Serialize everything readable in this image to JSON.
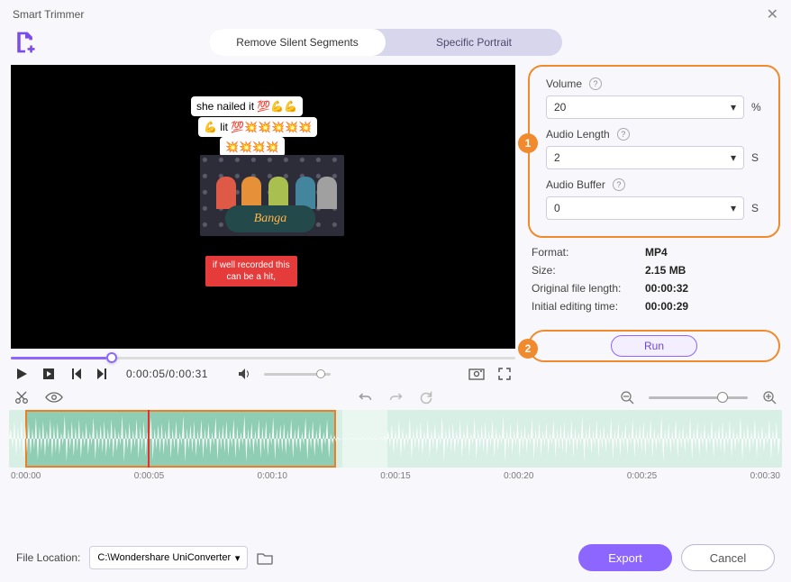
{
  "window": {
    "title": "Smart Trimmer"
  },
  "tabs": {
    "remove_silent": "Remove Silent Segments",
    "specific_portrait": "Specific Portrait"
  },
  "preview": {
    "sticker1": "she nailed it 💯💪💪",
    "sticker2": "💪 lit 💯💥💥💥💥💥",
    "sticker3": "💥💥💥💥",
    "banner": "Banga",
    "subtitle_l1": "if well recorded this",
    "subtitle_l2": "can be a hit,"
  },
  "playback": {
    "current": "0:00:05",
    "total": "0:00:31"
  },
  "options": {
    "volume_label": "Volume",
    "volume_value": "20",
    "volume_unit": "%",
    "audio_length_label": "Audio Length",
    "audio_length_value": "2",
    "audio_length_unit": "S",
    "audio_buffer_label": "Audio Buffer",
    "audio_buffer_value": "0",
    "audio_buffer_unit": "S"
  },
  "info": {
    "format_label": "Format:",
    "format_value": "MP4",
    "size_label": "Size:",
    "size_value": "2.15 MB",
    "orig_len_label": "Original file length:",
    "orig_len_value": "00:00:32",
    "init_edit_label": "Initial editing time:",
    "init_edit_value": "00:00:29"
  },
  "run_label": "Run",
  "badges": {
    "one": "1",
    "two": "2"
  },
  "ruler": [
    "0:00:00",
    "0:00:05",
    "0:00:10",
    "0:00:15",
    "0:00:20",
    "0:00:25",
    "0:00:30"
  ],
  "footer": {
    "file_location_label": "File Location:",
    "file_location_value": "C:\\Wondershare UniConverter",
    "export": "Export",
    "cancel": "Cancel"
  }
}
